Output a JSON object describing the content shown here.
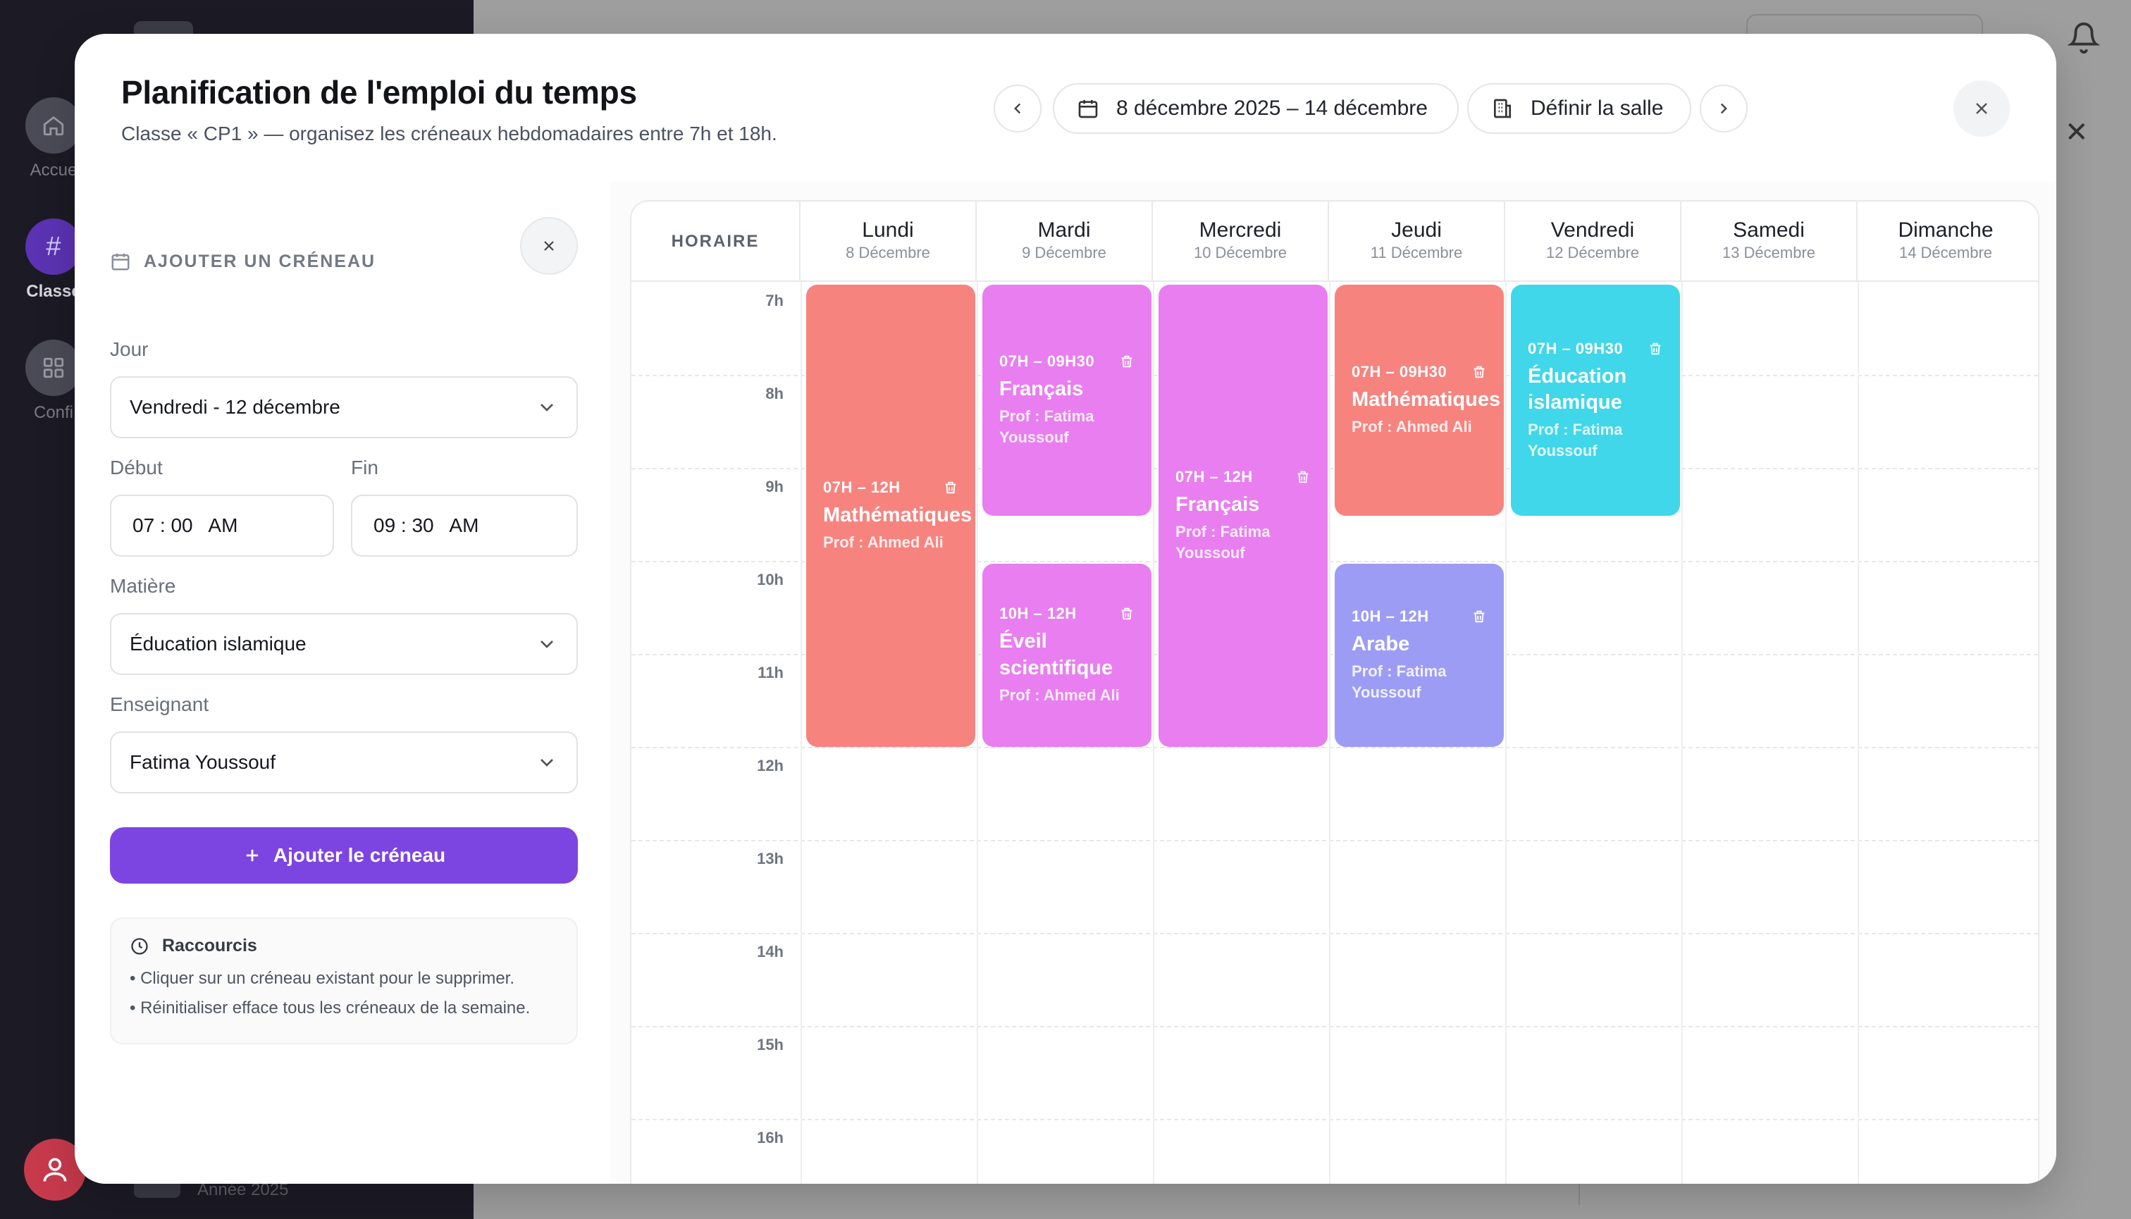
{
  "background": {
    "rail": [
      {
        "label": "Accue",
        "icon": "home-icon"
      },
      {
        "label": "Classe",
        "icon": "hash-icon"
      },
      {
        "label": "Confi",
        "icon": "grid-icon"
      }
    ],
    "year_label": "Année 2025"
  },
  "modal": {
    "title": "Planification de l'emploi du temps",
    "subtitle": "Classe « CP1 » — organisez les créneaux hebdomadaires entre 7h et 18h.",
    "week_range": "8 décembre 2025 – 14 décembre",
    "set_room_label": "Définir la salle"
  },
  "form": {
    "heading": "AJOUTER UN CRÉNEAU",
    "day_label": "Jour",
    "day_value": "Vendredi - 12 décembre",
    "start_label": "Début",
    "start_value": "07 : 00   AM",
    "end_label": "Fin",
    "end_value": "09 : 30   AM",
    "subject_label": "Matière",
    "subject_value": "Éducation islamique",
    "teacher_label": "Enseignant",
    "teacher_value": "Fatima Youssouf",
    "submit_label": "Ajouter le créneau"
  },
  "shortcuts": {
    "title": "Raccourcis",
    "items": [
      "• Cliquer sur un créneau existant pour le supprimer.",
      "• Réinitialiser efface tous les créneaux de la semaine."
    ]
  },
  "calendar": {
    "hour_header": "HORAIRE",
    "days": [
      {
        "name": "Lundi",
        "date": "8 Décembre"
      },
      {
        "name": "Mardi",
        "date": "9 Décembre"
      },
      {
        "name": "Mercredi",
        "date": "10 Décembre"
      },
      {
        "name": "Jeudi",
        "date": "11 Décembre"
      },
      {
        "name": "Vendredi",
        "date": "12 Décembre"
      },
      {
        "name": "Samedi",
        "date": "13 Décembre"
      },
      {
        "name": "Dimanche",
        "date": "14 Décembre"
      }
    ],
    "hours": [
      "7h",
      "8h",
      "9h",
      "10h",
      "11h",
      "12h",
      "13h",
      "14h",
      "15h",
      "16h"
    ],
    "events": [
      {
        "time": "07H – 12H",
        "title": "Mathématiques",
        "prof": "Prof : Ahmed Ali",
        "color": "#f7837f"
      },
      {
        "time": "07H – 09H30",
        "title": "Français",
        "prof": "Prof : Fatima Youssouf",
        "color": "#e97ef0"
      },
      {
        "time": "10H – 12H",
        "title": "Éveil scientifique",
        "prof": "Prof : Ahmed Ali",
        "color": "#e97ef0"
      },
      {
        "time": "07H – 12H",
        "title": "Français",
        "prof": "Prof : Fatima Youssouf",
        "color": "#e97ef0"
      },
      {
        "time": "07H – 09H30",
        "title": "Mathématiques",
        "prof": "Prof : Ahmed Ali",
        "color": "#f7837f"
      },
      {
        "time": "10H – 12H",
        "title": "Arabe",
        "prof": "Prof : Fatima Youssouf",
        "color": "#9d9cf4"
      },
      {
        "time": "07H – 09H30",
        "title": "Éducation islamique",
        "prof": "Prof : Fatima Youssouf",
        "color": "#3fd7e9"
      }
    ]
  },
  "colors": {
    "accent": "#7c45e1",
    "math": "#f7837f",
    "french": "#e97ef0",
    "arabic": "#9d9cf4",
    "islamic": "#3fd7e9"
  }
}
